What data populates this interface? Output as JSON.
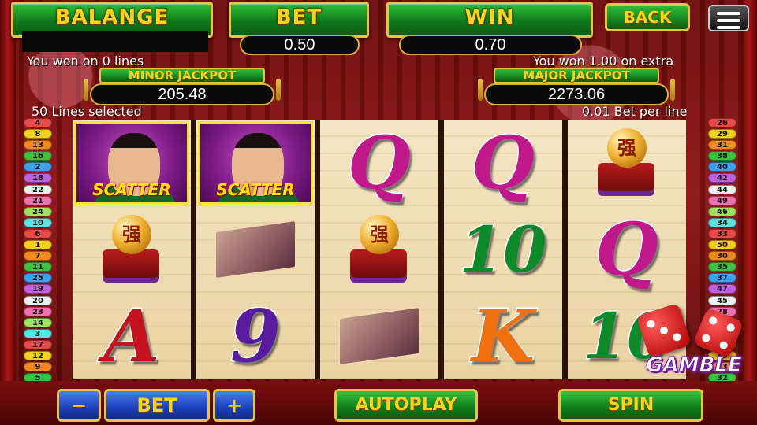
{
  "header": {
    "balance_label": "BALANGE",
    "bet_label": "BET",
    "bet_value": "0.50",
    "win_label": "WIN",
    "win_value": "0.70",
    "back_label": "BACK",
    "menu_icon": "hamburger-menu-icon"
  },
  "messages": {
    "won_lines": "You won on 0 lines",
    "won_extra": "You won 1.00 on extra",
    "lines_selected": "50 Lines selected",
    "bet_per_line": "0.01 Bet per line"
  },
  "jackpots": {
    "minor_label": "MINOR JACKPOT",
    "minor_value": "205.48",
    "major_label": "MAJOR JACKPOT",
    "major_value": "2273.06"
  },
  "reels": [
    [
      "scatter",
      "orb",
      "A"
    ],
    [
      "scatter",
      "scroll",
      "9"
    ],
    [
      "Q",
      "orb",
      "scroll"
    ],
    [
      "Q",
      "10",
      "K"
    ],
    [
      "orb",
      "Q",
      "10"
    ]
  ],
  "symbols": {
    "scatter_label": "SCATTER",
    "orb_glyph": "强",
    "colors": {
      "Q": "#c01a8a",
      "A": "#c41420",
      "9": "#5a1aa0",
      "10": "#0f8a2a",
      "K": "#f07010"
    }
  },
  "paylines": {
    "left": [
      "4",
      "8",
      "13",
      "16",
      "2",
      "18",
      "22",
      "21",
      "24",
      "10",
      "6",
      "1",
      "7",
      "11",
      "25",
      "19",
      "20",
      "23",
      "14",
      "3",
      "17",
      "12",
      "9",
      "5"
    ],
    "right": [
      "26",
      "29",
      "31",
      "38",
      "40",
      "42",
      "44",
      "49",
      "46",
      "34",
      "33",
      "50",
      "30",
      "35",
      "37",
      "47",
      "45",
      "28",
      "41",
      "48",
      "27",
      "39",
      "43",
      "32",
      "36"
    ],
    "colors": [
      "#e84a4a",
      "#f0d020",
      "#f08a20",
      "#40c040",
      "#40a0f0",
      "#c060e0",
      "#f0f0f0",
      "#f070b0",
      "#a0e060",
      "#60e0e0"
    ]
  },
  "controls": {
    "minus_label": "−",
    "bet_label": "BET",
    "plus_label": "+",
    "autoplay_label": "AUTOPLAY",
    "spin_label": "SPIN",
    "gamble_label": "GAMBLE"
  }
}
